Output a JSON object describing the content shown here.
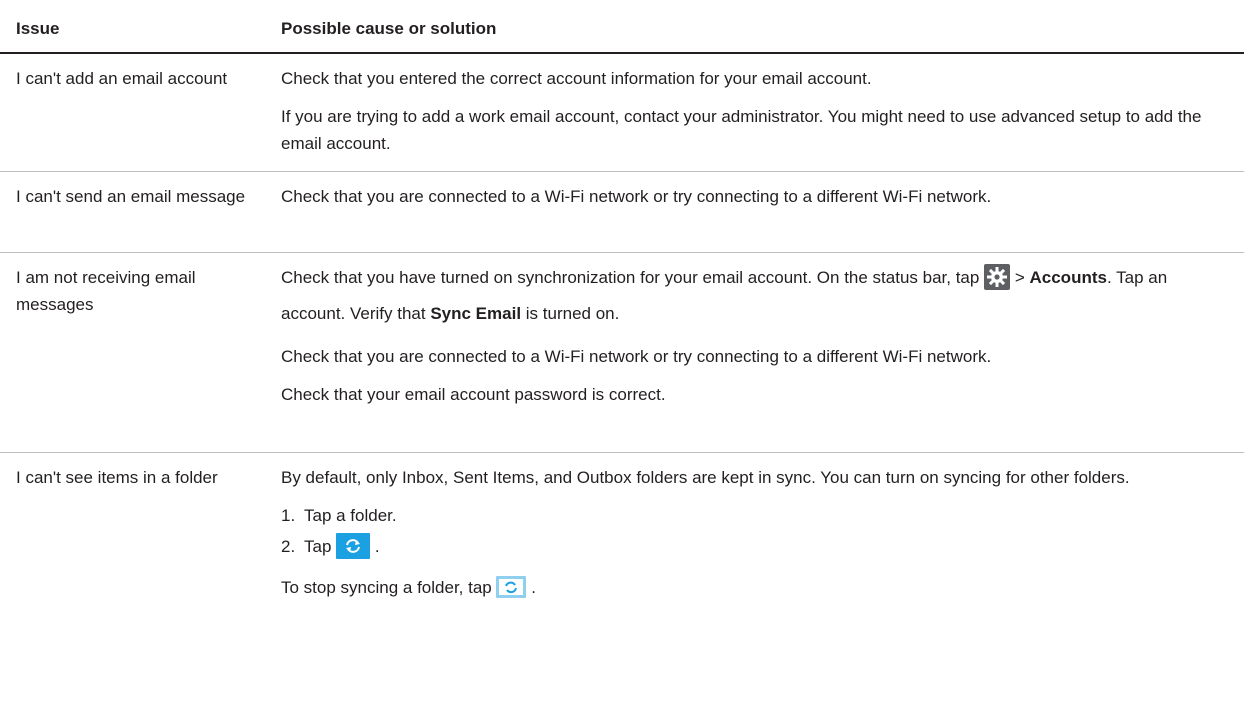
{
  "table": {
    "header": {
      "issue": "Issue",
      "solution": "Possible cause or solution"
    },
    "rows": [
      {
        "issue": "I can't add an email account",
        "p1": "Check that you entered the correct account information for your email account.",
        "p2": "If you are trying to add a work email account, contact your administrator. You might need to use advanced setup to add the email account."
      },
      {
        "issue": "I can't send an email message",
        "p1": "Check that you are connected to a Wi-Fi network or try connecting to a different Wi-Fi network."
      },
      {
        "issue": "I am not receiving email messages",
        "p1_a": "Check that you have turned on synchronization for your email account. On the status bar, tap",
        "p1_gt": ">",
        "p1_accounts": "Accounts",
        "p1_b": ". Tap an account. Verify that",
        "p1_sync": "Sync Email",
        "p1_c": "is turned on.",
        "p2": "Check that you are connected to a Wi-Fi network or try connecting to a different Wi-Fi network.",
        "p3": "Check that your email account password is correct."
      },
      {
        "issue": "I can't see items in a folder",
        "p1": "By default, only Inbox, Sent Items, and Outbox folders are kept in sync. You can turn on syncing for other folders.",
        "steps": [
          {
            "num": "1.",
            "text": "Tap a folder."
          },
          {
            "num": "2.",
            "text": "Tap",
            "after": "."
          }
        ],
        "stop_a": "To stop syncing a folder, tap",
        "stop_b": "."
      }
    ]
  },
  "icons": {
    "settings": "gear-icon",
    "sync": "folder-sync-icon",
    "sync_off": "folder-stop-sync-icon"
  },
  "colors": {
    "text": "#231f20",
    "rule": "#bcbec0",
    "icon_blue": "#1ba1e2",
    "icon_gray": "#5d5f62"
  }
}
